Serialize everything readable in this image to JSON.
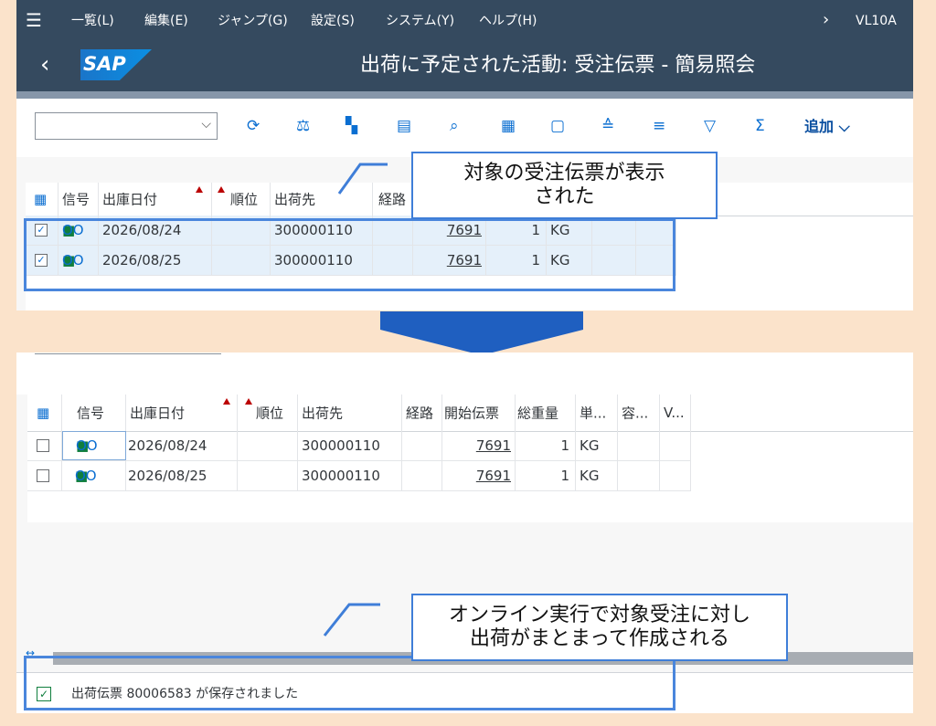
{
  "menubar": {
    "items": [
      "一覧(L)",
      "編集(E)",
      "ジャンプ(G)",
      "設定(S)",
      "システム(Y)",
      "ヘルプ(H)"
    ],
    "tcode": "VL10A"
  },
  "titlebar": {
    "logo": "SAP",
    "title": "出荷に予定された活動: 受注伝票 - 簡易照会"
  },
  "toolbar": {
    "add_label": "追加"
  },
  "grid1": {
    "headers": [
      "信号",
      "出庫日付",
      "順位",
      "出荷先",
      "経路"
    ],
    "rows": [
      {
        "signal": "OO",
        "date": "2026/08/24",
        "shipto": "300000110",
        "doc": "7691",
        "qty": "1",
        "unit": "KG"
      },
      {
        "signal": "OO",
        "date": "2026/08/25",
        "shipto": "300000110",
        "doc": "7691",
        "qty": "1",
        "unit": "KG"
      }
    ]
  },
  "grid2": {
    "headers": [
      "信号",
      "出庫日付",
      "順位",
      "出荷先",
      "経路",
      "開始伝票",
      "総重量",
      "単...",
      "容...",
      "V..."
    ],
    "rows": [
      {
        "signal": "OO",
        "date": "2026/08/24",
        "shipto": "300000110",
        "doc": "7691",
        "qty": "1",
        "unit": "KG"
      },
      {
        "signal": "OO",
        "date": "2026/08/25",
        "shipto": "300000110",
        "doc": "7691",
        "qty": "1",
        "unit": "KG"
      }
    ]
  },
  "status": {
    "message": "出荷伝票 80006583 が保存されました"
  },
  "callouts": {
    "top_line1": "対象の受注伝票が表示",
    "top_line2": "された",
    "bottom_line1": "オンライン実行で対象受注に対し",
    "bottom_line2": "出荷がまとまって作成される"
  },
  "colors": {
    "shell": "#354a5f",
    "accent": "#0a6ed1",
    "callout_border": "#3f7ed8",
    "background": "#fbe3cb"
  }
}
